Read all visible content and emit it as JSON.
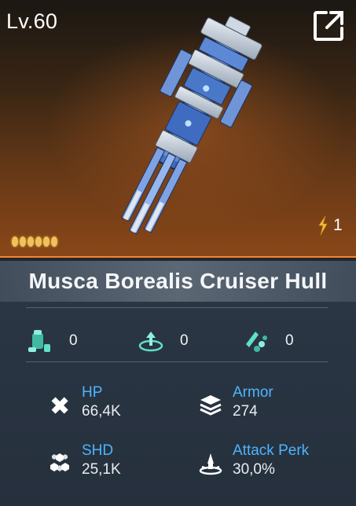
{
  "card": {
    "level": "Lv.60",
    "count": "1",
    "tier_pips": 6,
    "title": "Musca Borealis Cruiser Hull"
  },
  "resources": [
    {
      "icon": "module-icon",
      "value": "0"
    },
    {
      "icon": "upgrade-icon",
      "value": "0"
    },
    {
      "icon": "missile-icon",
      "value": "0"
    }
  ],
  "stats": {
    "hp": {
      "label": "HP",
      "value": "66,4K"
    },
    "armor": {
      "label": "Armor",
      "value": "274"
    },
    "shd": {
      "label": "SHD",
      "value": "25,1K"
    },
    "attack_perk": {
      "label": "Attack Perk",
      "value": "30,0%"
    }
  },
  "colors": {
    "accent_orange": "#ff8a2a",
    "stat_label_blue": "#4db4ff",
    "tier_gold": "#f0c25a",
    "resource_teal": "#5fe0c8"
  }
}
